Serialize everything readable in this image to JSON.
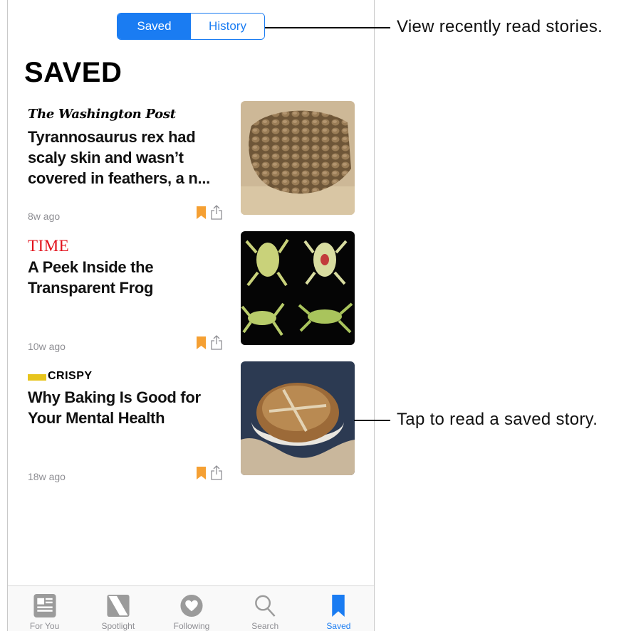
{
  "segment": {
    "saved_label": "Saved",
    "history_label": "History",
    "active": "Saved"
  },
  "page_title": "SAVED",
  "articles": [
    {
      "source": "The Washington Post",
      "headline": "Tyrannosaurus rex had scaly skin and wasn’t covered in feathers, a n...",
      "time": "8w ago",
      "image": "dinosaur-skin-fossil"
    },
    {
      "source": "TIME",
      "headline": "A Peek Inside the Transparent Frog",
      "time": "10w ago",
      "image": "glass-frogs"
    },
    {
      "source": "CRISPY",
      "headline": "Why Baking Is Good for Your Mental Health",
      "time": "18w ago",
      "image": "bread-loaf"
    }
  ],
  "tabbar": {
    "items": [
      {
        "label": "For You",
        "icon": "newspaper-icon"
      },
      {
        "label": "Spotlight",
        "icon": "spotlight-icon"
      },
      {
        "label": "Following",
        "icon": "heart-icon"
      },
      {
        "label": "Search",
        "icon": "search-icon"
      },
      {
        "label": "Saved",
        "icon": "bookmark-icon",
        "active": true
      }
    ]
  },
  "callouts": {
    "history": "View recently read stories.",
    "saved_story": "Tap to read a saved story."
  },
  "colors": {
    "accent": "#1a7cf2",
    "bookmark": "#f5a033",
    "time_red": "#e2101b"
  }
}
